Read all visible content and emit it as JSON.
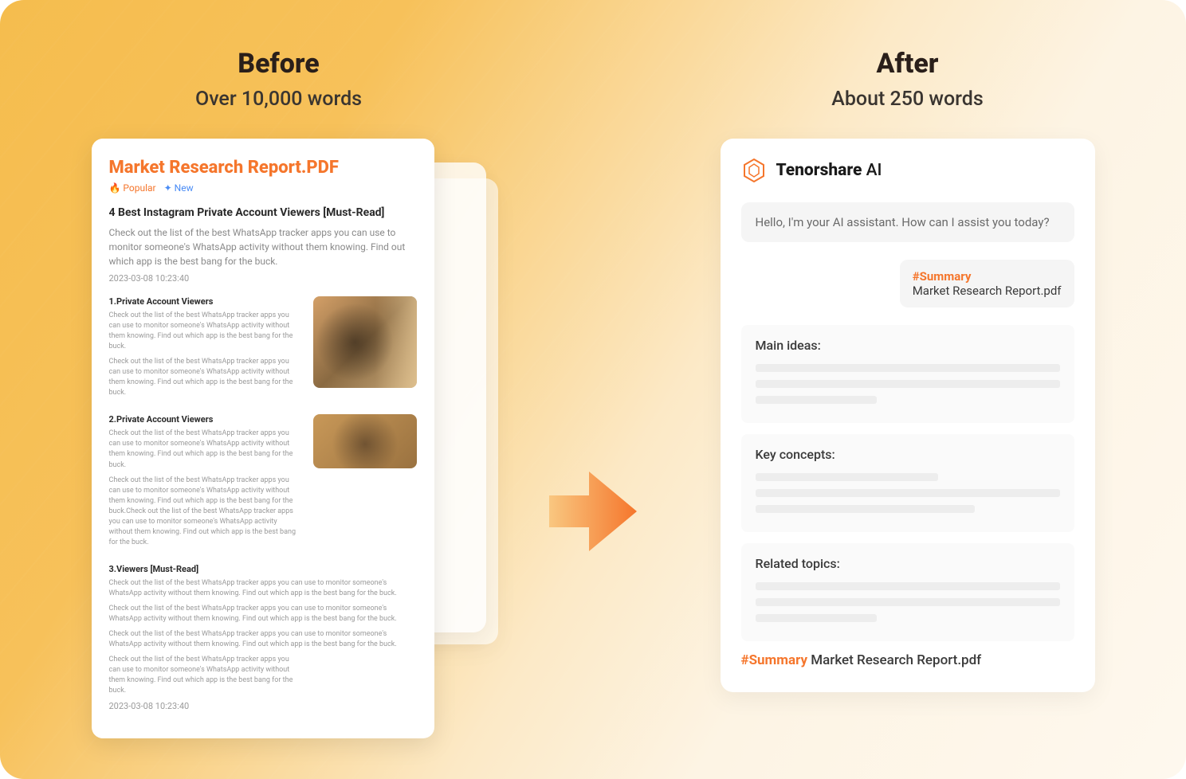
{
  "before": {
    "title": "Before",
    "subtitle": "Over 10,000 words",
    "doc": {
      "title": "Market Research Report.PDF",
      "tag_popular": "Popular",
      "tag_new": "New",
      "heading": "4 Best Instagram Private Account Viewers [Must-Read]",
      "lead": "Check out the list of the best WhatsApp tracker apps you can use to monitor someone's WhatsApp activity without them knowing. Find out which app is the best bang for the buck.",
      "timestamp1": "2023-03-08 10:23:40",
      "s1_title": "1.Private Account Viewers",
      "s1_p1": "Check out the list of the best WhatsApp tracker apps you can use to monitor someone's WhatsApp activity without them knowing. Find out which app is the best bang for the buck.",
      "s1_p2": "Check out the list of the best WhatsApp tracker apps you can use to monitor someone's WhatsApp activity without them knowing. Find out which app is the best bang for the buck.",
      "s2_title": "2.Private Account Viewers",
      "s2_p1": "Check out the list of the best WhatsApp tracker apps you can use to monitor someone's WhatsApp activity without them knowing. Find out which app is the best bang for the buck.",
      "s2_p2": "Check out the list of the best WhatsApp tracker apps you can use to monitor someone's WhatsApp activity without them knowing. Find out which app is the best bang for the buck.Check out the list of the best WhatsApp tracker apps you can use to monitor someone's WhatsApp activity without them knowing. Find out which app is the best bang for the buck.",
      "s3_title": "3.Viewers [Must-Read]",
      "s3_p1": "Check out the list of the best WhatsApp tracker apps you can use to monitor someone's WhatsApp activity without them knowing. Find out which app is the best bang for the buck.",
      "s3_p2": "Check out the list of the best WhatsApp tracker apps you can use to monitor someone's WhatsApp activity without them knowing. Find out which app is the best bang for the buck.",
      "s3_p3": "Check out the list of the best WhatsApp tracker apps you can use to monitor someone's WhatsApp activity without them knowing. Find out which app is the best bang for the buck.",
      "s3_p4": "Check out the list of the best WhatsApp tracker apps you can use to monitor someone's WhatsApp activity without them knowing. Find out which app is the best bang for the buck.",
      "timestamp2": "2023-03-08 10:23:40"
    }
  },
  "after": {
    "title": "After",
    "subtitle": "About 250 words",
    "brand": "Tenorshare",
    "brand_suffix": " AI",
    "greeting": "Hello, I'm your AI assistant. How can I assist you today?",
    "summary_hash": "#Summary",
    "summary_file": "Market Research Report.pdf",
    "block1": "Main ideas:",
    "block2": "Key concepts:",
    "block3": "Related topics:",
    "cmd_hash": "#Summary",
    "cmd_file": " Market Research Report.pdf"
  }
}
